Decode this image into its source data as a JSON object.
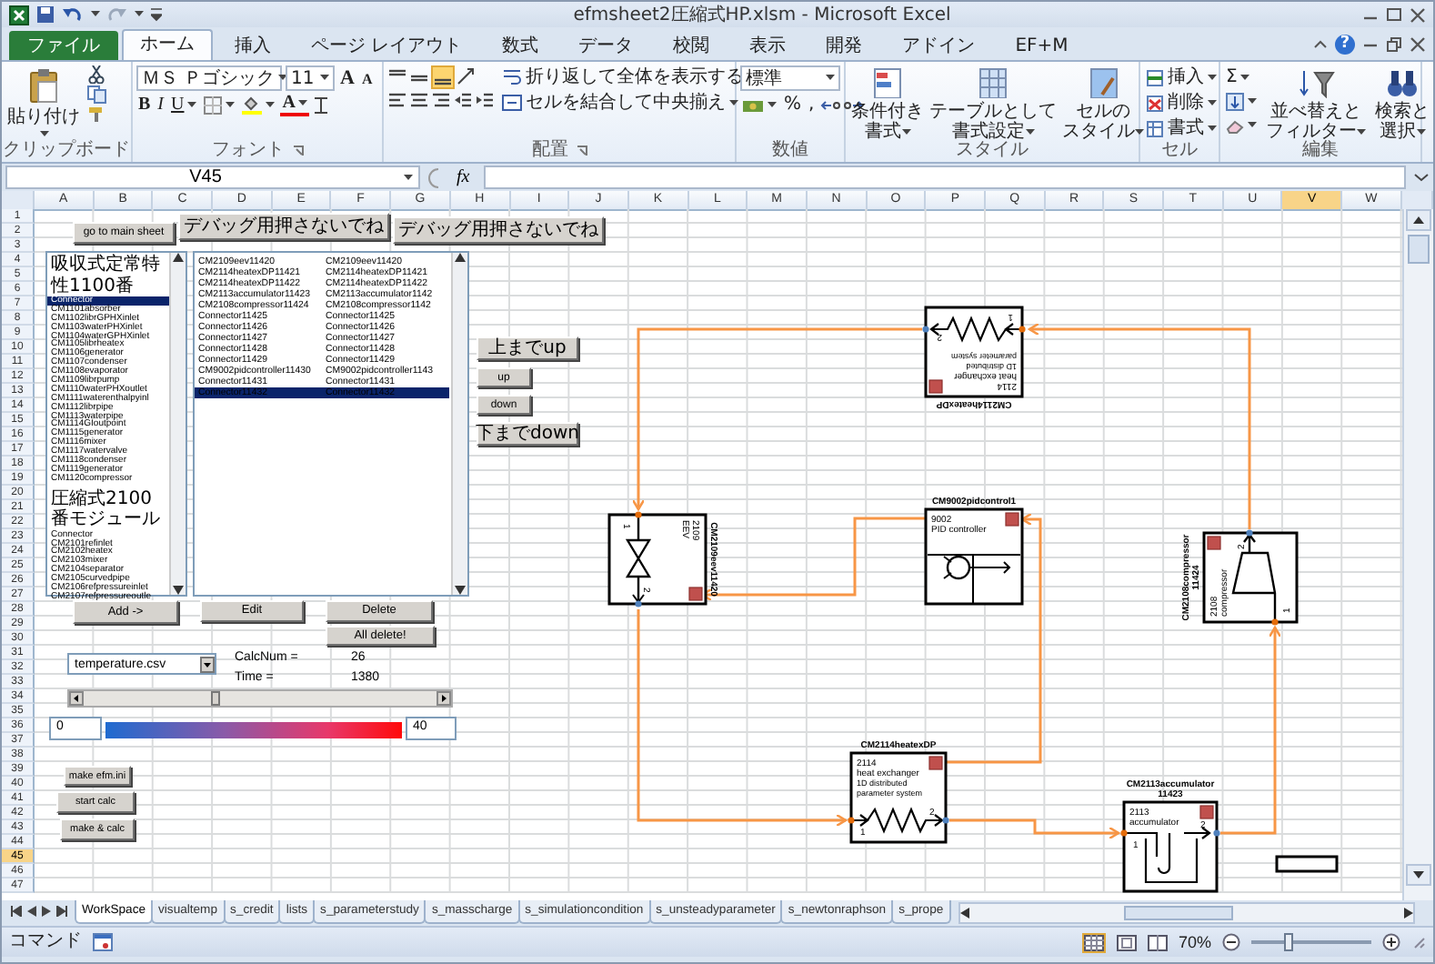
{
  "window": {
    "title": "efmsheet2圧縮式HP.xlsm - Microsoft Excel"
  },
  "help": "?",
  "ribbon_tabs": [
    {
      "label": "ファイル",
      "kind": "file",
      "selected": false
    },
    {
      "label": "ホーム",
      "kind": "tab",
      "selected": true
    },
    {
      "label": "挿入",
      "kind": "tab",
      "selected": false
    },
    {
      "label": "ページ レイアウト",
      "kind": "tab",
      "selected": false
    },
    {
      "label": "数式",
      "kind": "tab",
      "selected": false
    },
    {
      "label": "データ",
      "kind": "tab",
      "selected": false
    },
    {
      "label": "校閲",
      "kind": "tab",
      "selected": false
    },
    {
      "label": "表示",
      "kind": "tab",
      "selected": false
    },
    {
      "label": "開発",
      "kind": "tab",
      "selected": false
    },
    {
      "label": "アドイン",
      "kind": "tab",
      "selected": false
    },
    {
      "label": "EF+M",
      "kind": "tab",
      "selected": false
    }
  ],
  "clipboard": {
    "paste": "貼り付け",
    "title": "クリップボード"
  },
  "font": {
    "name": "ＭＳ Ｐゴシック",
    "size": "11",
    "grow": "A",
    "shrink": "A",
    "bold": "B",
    "italic": "I",
    "underline": "U",
    "font_color": "A",
    "title": "フォント"
  },
  "alignment": {
    "wrap": "折り返して全体を表示する",
    "merge": "セルを結合して中央揃え",
    "title": "配置"
  },
  "number": {
    "format": "標準",
    "percent": "%",
    "comma": ",",
    "title": "数値"
  },
  "styles": {
    "items": [
      {
        "lines": [
          "条件付き",
          "書式"
        ]
      },
      {
        "lines": [
          "テーブルとして",
          "書式設定"
        ]
      },
      {
        "lines": [
          "セルの",
          "スタイル"
        ]
      }
    ],
    "title": "スタイル"
  },
  "cells": {
    "items": [
      "挿入",
      "削除",
      "書式"
    ],
    "title": "セル"
  },
  "editing": {
    "sum": "Σ",
    "items": [
      {
        "lines": [
          "並べ替えと",
          "フィルター"
        ]
      },
      {
        "lines": [
          "検索と",
          "選択"
        ]
      }
    ],
    "title": "編集"
  },
  "formula_bar": {
    "name_box": "V45",
    "fx": "fx"
  },
  "columns": [
    {
      "label": "A",
      "selected": false
    },
    {
      "label": "B",
      "selected": false
    },
    {
      "label": "C",
      "selected": false
    },
    {
      "label": "D",
      "selected": false
    },
    {
      "label": "E",
      "selected": false
    },
    {
      "label": "F",
      "selected": false
    },
    {
      "label": "G",
      "selected": false
    },
    {
      "label": "H",
      "selected": false
    },
    {
      "label": "I",
      "selected": false
    },
    {
      "label": "J",
      "selected": false
    },
    {
      "label": "K",
      "selected": false
    },
    {
      "label": "L",
      "selected": false
    },
    {
      "label": "M",
      "selected": false
    },
    {
      "label": "N",
      "selected": false
    },
    {
      "label": "O",
      "selected": false
    },
    {
      "label": "P",
      "selected": false
    },
    {
      "label": "Q",
      "selected": false
    },
    {
      "label": "R",
      "selected": false
    },
    {
      "label": "S",
      "selected": false
    },
    {
      "label": "T",
      "selected": false
    },
    {
      "label": "U",
      "selected": false
    },
    {
      "label": "V",
      "selected": true
    },
    {
      "label": "W",
      "selected": false
    }
  ],
  "rows": [
    {
      "label": "1",
      "selected": false
    },
    {
      "label": "2",
      "selected": false
    },
    {
      "label": "3",
      "selected": false
    },
    {
      "label": "4",
      "selected": false
    },
    {
      "label": "5",
      "selected": false
    },
    {
      "label": "6",
      "selected": false
    },
    {
      "label": "7",
      "selected": false
    },
    {
      "label": "8",
      "selected": false
    },
    {
      "label": "9",
      "selected": false
    },
    {
      "label": "10",
      "selected": false
    },
    {
      "label": "11",
      "selected": false
    },
    {
      "label": "12",
      "selected": false
    },
    {
      "label": "13",
      "selected": false
    },
    {
      "label": "14",
      "selected": false
    },
    {
      "label": "15",
      "selected": false
    },
    {
      "label": "16",
      "selected": false
    },
    {
      "label": "17",
      "selected": false
    },
    {
      "label": "18",
      "selected": false
    },
    {
      "label": "19",
      "selected": false
    },
    {
      "label": "20",
      "selected": false
    },
    {
      "label": "21",
      "selected": false
    },
    {
      "label": "22",
      "selected": false
    },
    {
      "label": "23",
      "selected": false
    },
    {
      "label": "24",
      "selected": false
    },
    {
      "label": "25",
      "selected": false
    },
    {
      "label": "26",
      "selected": false
    },
    {
      "label": "27",
      "selected": false
    },
    {
      "label": "28",
      "selected": false
    },
    {
      "label": "29",
      "selected": false
    },
    {
      "label": "30",
      "selected": false
    },
    {
      "label": "31",
      "selected": false
    },
    {
      "label": "32",
      "selected": false
    },
    {
      "label": "33",
      "selected": false
    },
    {
      "label": "34",
      "selected": false
    },
    {
      "label": "35",
      "selected": false
    },
    {
      "label": "36",
      "selected": false
    },
    {
      "label": "37",
      "selected": false
    },
    {
      "label": "38",
      "selected": false
    },
    {
      "label": "39",
      "selected": false
    },
    {
      "label": "40",
      "selected": false
    },
    {
      "label": "41",
      "selected": false
    },
    {
      "label": "42",
      "selected": false
    },
    {
      "label": "43",
      "selected": false
    },
    {
      "label": "44",
      "selected": false
    },
    {
      "label": "45",
      "selected": true
    },
    {
      "label": "46",
      "selected": false
    },
    {
      "label": "47",
      "selected": false
    }
  ],
  "sheet": {
    "top_buttons": [
      "go to main sheet",
      "デバッグ用押さないでね",
      "デバッグ用押さないでね"
    ],
    "component_list": [
      {
        "label": "吸収式定常特性1100番",
        "kind": "header",
        "selected": false
      },
      {
        "label": "Connector",
        "kind": "item",
        "selected": true
      },
      {
        "label": "CM1101absorber",
        "kind": "item",
        "selected": false
      },
      {
        "label": "CM1102librGPHXinlet",
        "kind": "item",
        "selected": false
      },
      {
        "label": "CM1103waterPHXinlet",
        "kind": "item",
        "selected": false
      },
      {
        "label": "CM1104waterGPHXinlet",
        "kind": "item",
        "selected": false
      },
      {
        "label": "CM1105librheatex",
        "kind": "item",
        "selected": false
      },
      {
        "label": "CM1106generator",
        "kind": "item",
        "selected": false
      },
      {
        "label": "CM1107condenser",
        "kind": "item",
        "selected": false
      },
      {
        "label": "CM1108evaporator",
        "kind": "item",
        "selected": false
      },
      {
        "label": "CM1109librpump",
        "kind": "item",
        "selected": false
      },
      {
        "label": "CM1110waterPHXoutlet",
        "kind": "item",
        "selected": false
      },
      {
        "label": "CM1111waterenthalpyinl",
        "kind": "item",
        "selected": false
      },
      {
        "label": "CM1112librpipe",
        "kind": "item",
        "selected": false
      },
      {
        "label": "CM1113waterpipe",
        "kind": "item",
        "selected": false
      },
      {
        "label": "CM1114GIoutpoint",
        "kind": "item",
        "selected": false
      },
      {
        "label": "CM1115generator",
        "kind": "item",
        "selected": false
      },
      {
        "label": "CM1116mixer",
        "kind": "item",
        "selected": false
      },
      {
        "label": "CM1117watervalve",
        "kind": "item",
        "selected": false
      },
      {
        "label": "CM1118condenser",
        "kind": "item",
        "selected": false
      },
      {
        "label": "CM1119generator",
        "kind": "item",
        "selected": false
      },
      {
        "label": "CM1120compressor",
        "kind": "item",
        "selected": false
      },
      {
        "label": "圧縮式2100番モジュール",
        "kind": "header",
        "selected": false
      },
      {
        "label": "Connector",
        "kind": "item",
        "selected": false
      },
      {
        "label": "CM2101refinlet",
        "kind": "item",
        "selected": false
      },
      {
        "label": "CM2102heatex",
        "kind": "item",
        "selected": false
      },
      {
        "label": "CM2103mixer",
        "kind": "item",
        "selected": false
      },
      {
        "label": "CM2104separator",
        "kind": "item",
        "selected": false
      },
      {
        "label": "CM2105curvedpipe",
        "kind": "item",
        "selected": false
      },
      {
        "label": "CM2106refpressureinlet",
        "kind": "item",
        "selected": false
      },
      {
        "label": "CM2107refpressureoutle",
        "kind": "item",
        "selected": false
      }
    ],
    "connection_list": [
      {
        "cells": [
          "CM2109eev11420",
          "CM2109eev11420"
        ],
        "selected": false
      },
      {
        "cells": [
          "CM2114heatexDP11421",
          "CM2114heatexDP11421"
        ],
        "selected": false
      },
      {
        "cells": [
          "CM2114heatexDP11422",
          "CM2114heatexDP11422"
        ],
        "selected": false
      },
      {
        "cells": [
          "CM2113accumulator11423",
          "CM2113accumulator1142"
        ],
        "selected": false
      },
      {
        "cells": [
          "CM2108compressor11424",
          "CM2108compressor1142"
        ],
        "selected": false
      },
      {
        "cells": [
          "Connector11425",
          "Connector11425"
        ],
        "selected": false
      },
      {
        "cells": [
          "Connector11426",
          "Connector11426"
        ],
        "selected": false
      },
      {
        "cells": [
          "Connector11427",
          "Connector11427"
        ],
        "selected": false
      },
      {
        "cells": [
          "Connector11428",
          "Connector11428"
        ],
        "selected": false
      },
      {
        "cells": [
          "Connector11429",
          "Connector11429"
        ],
        "selected": false
      },
      {
        "cells": [
          "CM9002pidcontroller11430",
          "CM9002pidcontroller1143"
        ],
        "selected": false
      },
      {
        "cells": [
          "Connector11431",
          "Connector11431"
        ],
        "selected": false
      },
      {
        "cells": [
          "Connector11432",
          "Connector11432"
        ],
        "selected": true
      }
    ],
    "move_buttons": [
      "上までup",
      "up",
      "down",
      "下までdown"
    ],
    "edit_buttons": [
      "Add ->",
      "Edit",
      "Delete",
      "All delete!"
    ],
    "file_dropdown": "temperature.csv",
    "calc_info": [
      {
        "label": "CalcNum =",
        "value": "26"
      },
      {
        "label": "Time =",
        "value": "1380"
      }
    ],
    "time_slider": {
      "level": 0.37
    },
    "legend": {
      "min": "0",
      "max": "40"
    },
    "run_buttons": [
      "make efm.ini",
      "start calc",
      "make & calc"
    ],
    "diagram": [
      {
        "kind": "heatex",
        "label": [
          "CM2114heatexDP"
        ],
        "lines": [
          "2114",
          "heat exchanger",
          "1D distributed",
          "parameter system"
        ],
        "ports": [
          "1",
          "2"
        ]
      },
      {
        "kind": "eev",
        "label": [
          "CM2109eev11420"
        ],
        "lines": [
          "2109",
          "EEV"
        ],
        "ports": [
          "1",
          "2"
        ]
      },
      {
        "kind": "pid",
        "label": [
          "CM9002pidcontrol1"
        ],
        "lines": [
          "9002",
          "PID controller"
        ]
      },
      {
        "kind": "compressor",
        "label": [
          "CM2108compressor",
          "11424"
        ],
        "lines": [
          "2108",
          "compressor"
        ],
        "ports": [
          "1",
          "2"
        ]
      },
      {
        "kind": "heatex",
        "label": [
          "CM2114heatexDP"
        ],
        "lines": [
          "2114",
          "heat exchanger",
          "1D distributed",
          "parameter system"
        ],
        "ports": [
          "1",
          "2"
        ]
      },
      {
        "kind": "accumulator",
        "label": [
          "CM2113accumulator",
          "11423"
        ],
        "lines": [
          "2113",
          "accumulator"
        ],
        "ports": [
          "1",
          "2"
        ]
      }
    ]
  },
  "sheet_tabs": [
    {
      "label": "WorkSpace",
      "selected": true
    },
    {
      "label": "visualtemp",
      "selected": false
    },
    {
      "label": "s_credit",
      "selected": false
    },
    {
      "label": "lists",
      "selected": false
    },
    {
      "label": "s_parameterstudy",
      "selected": false
    },
    {
      "label": "s_masscharge",
      "selected": false
    },
    {
      "label": "s_simulationcondition",
      "selected": false
    },
    {
      "label": "s_unsteadyparameter",
      "selected": false
    },
    {
      "label": "s_newtonraphson",
      "selected": false
    },
    {
      "label": "s_prope",
      "selected": false
    }
  ],
  "status_bar": {
    "mode": "コマンド",
    "zoom": "70%",
    "zoom_slider": {
      "level": 0.3
    }
  }
}
